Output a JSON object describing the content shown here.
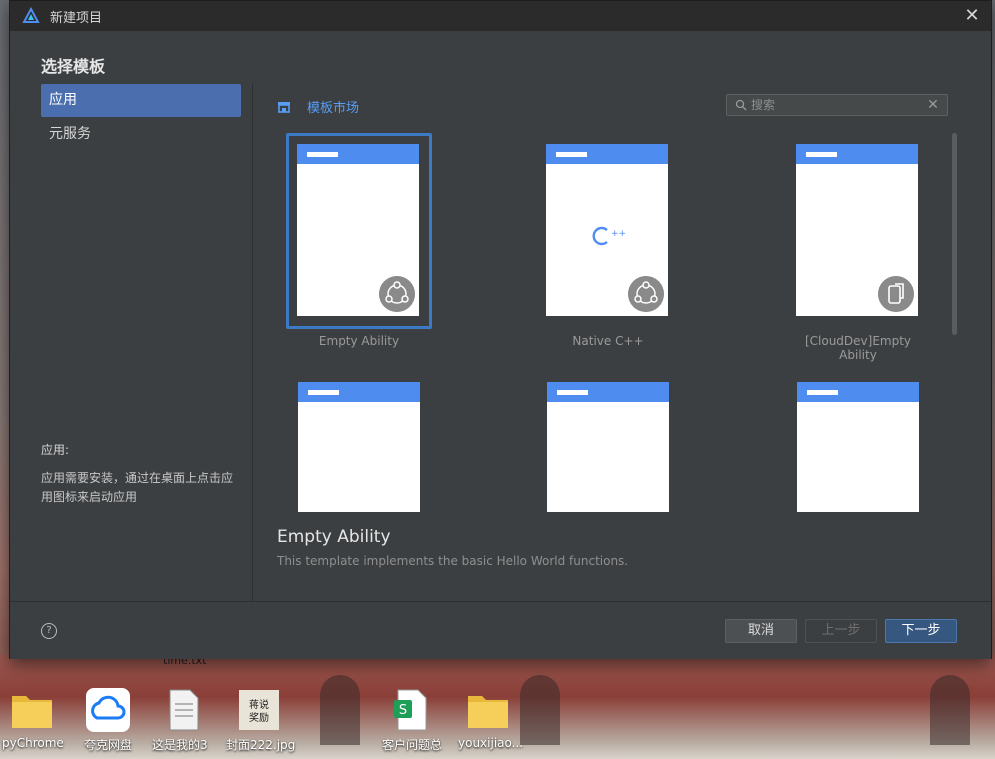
{
  "window": {
    "title": "新建项目",
    "close_symbol": "✕"
  },
  "heading": "选择模板",
  "categories": [
    {
      "label": "应用"
    },
    {
      "label": "元服务"
    }
  ],
  "category_description": {
    "title": "应用:",
    "body": "应用需要安装，通过在桌面上点击应用图标来启动应用"
  },
  "market": {
    "label": "模板市场"
  },
  "search": {
    "placeholder": "搜索",
    "value": ""
  },
  "templates": [
    {
      "name": "Empty Ability",
      "icon": "ability-icon",
      "selected": true
    },
    {
      "name": "Native C++",
      "icon": "cpp-icon",
      "selected": false
    },
    {
      "name": "[CloudDev]Empty Ability",
      "icon": "cloud-dev-icon",
      "selected": false
    }
  ],
  "selected_template": {
    "name": "Empty Ability",
    "description": "This template implements the basic Hello World functions."
  },
  "footer": {
    "help_symbol": "?",
    "cancel_label": "取消",
    "prev_label": "上一步",
    "next_label": "下一步"
  },
  "desktop": {
    "top_label": "time.txt",
    "icons": [
      {
        "label": "pyChrome",
        "icon": "folder-icon"
      },
      {
        "label": "夸克网盘",
        "icon": "cloud-drive-icon"
      },
      {
        "label": "这是我的3",
        "icon": "text-file-icon"
      },
      {
        "label": "封面222.jpg",
        "icon": "image-file-icon"
      },
      {
        "label": "客户问题总",
        "icon": "spreadsheet-icon"
      },
      {
        "label": "youxijiao...",
        "icon": "folder-icon"
      }
    ]
  },
  "colors": {
    "accent": "#4b6eaf",
    "selection_border": "#3d7ac6",
    "link": "#589df6",
    "thumb_header": "#4f8cf0"
  }
}
